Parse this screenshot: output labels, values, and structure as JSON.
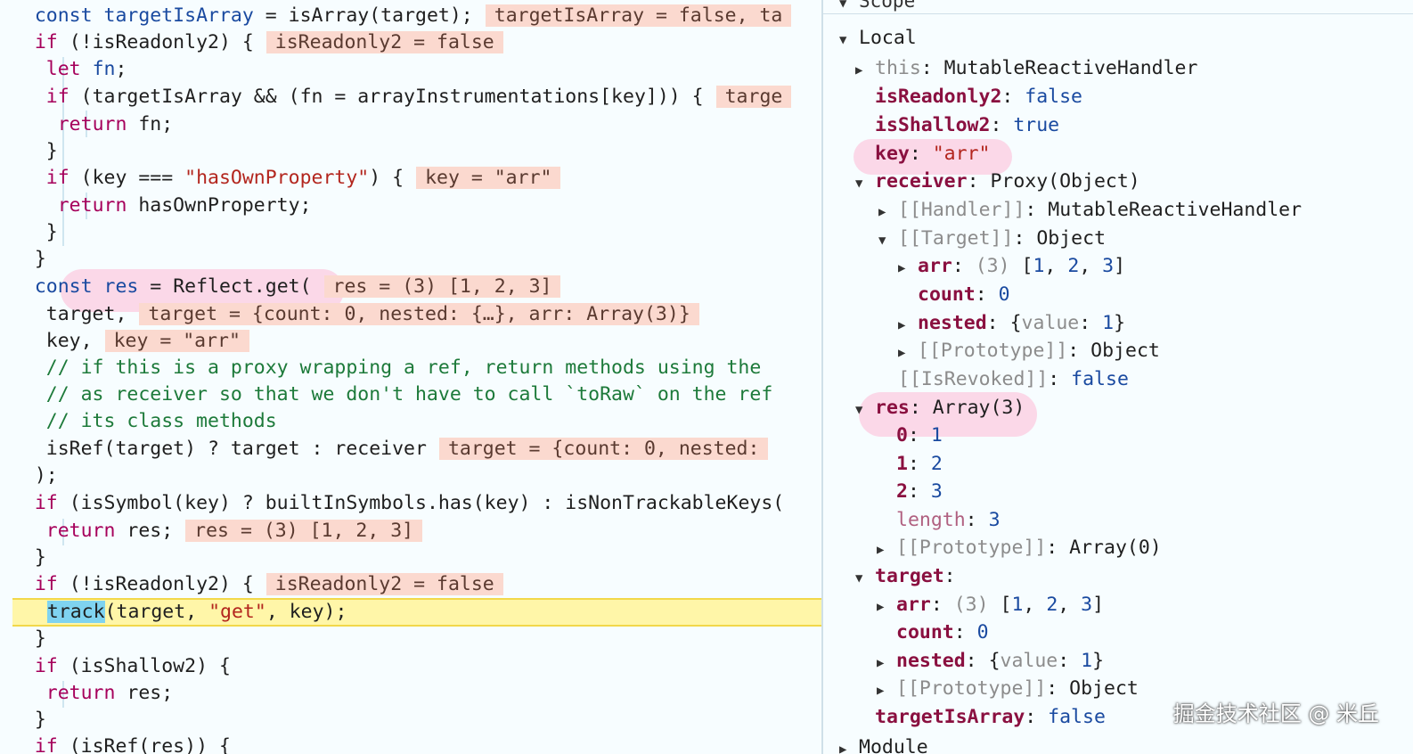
{
  "code": {
    "l1": {
      "a": "const ",
      "b": "targetIsArray",
      "c": " = isArray(target);",
      "inline": "targetIsArray = false, ta"
    },
    "l2": {
      "a": "if ",
      "b": "(!isReadonly2) {",
      "inline": "isReadonly2 = false"
    },
    "l3": {
      "a": "let ",
      "b": "fn",
      "c": ";"
    },
    "l4": {
      "a": "if ",
      "b": "(targetIsArray && (fn = arrayInstrumentations[key])) {",
      "inline": "targe"
    },
    "l5": {
      "a": "return ",
      "b": "fn;"
    },
    "l6": "}",
    "l7": {
      "a": "if ",
      "b": "(key === ",
      "s": "\"hasOwnProperty\"",
      "c": ") {",
      "inline": "key = \"arr\""
    },
    "l8": {
      "a": "return ",
      "b": "hasOwnProperty;"
    },
    "l9": "}",
    "l10": "}",
    "l11": {
      "a": "const ",
      "b": "res",
      "c": " = Reflect.get(",
      "inline": "res = (3) [1, 2, 3]"
    },
    "l12": {
      "b": "target,",
      "inline": "target = {count: 0, nested: {…}, arr: Array(3)}"
    },
    "l13": {
      "b": "key,",
      "inline": "key = \"arr\""
    },
    "l14": "// if this is a proxy wrapping a ref, return methods using the",
    "l15": "// as receiver so that we don't have to call `toRaw` on the ref",
    "l16": "// its class methods",
    "l17": {
      "b": "isRef(target) ? target : receiver",
      "inline": "target = {count: 0, nested:"
    },
    "l18": ");",
    "l19": {
      "a": "if ",
      "b": "(isSymbol(key) ? builtInSymbols.has(key) : isNonTrackableKeys("
    },
    "l20": {
      "a": "return ",
      "b": "res;",
      "inline": "res = (3) [1, 2, 3]"
    },
    "l21": "}",
    "l22": {
      "a": "if ",
      "b": "(!isReadonly2) {",
      "inline": "isReadonly2 = false"
    },
    "l23": {
      "sel": "track",
      "b": "(target, ",
      "s": "\"get\"",
      "c": ", key);"
    },
    "l24": "}",
    "l25": {
      "a": "if ",
      "b": "(isShallow2) {"
    },
    "l26": {
      "a": "return ",
      "b": "res;"
    },
    "l27": "}",
    "l28": {
      "a": "if ",
      "b": "(isRef(res)) {"
    }
  },
  "scope": {
    "header": "Scope",
    "local": "Local",
    "rows": [
      {
        "k": "this",
        "v": "MutableReactiveHandler"
      },
      {
        "k": "isReadonly2",
        "v": "false"
      },
      {
        "k": "isShallow2",
        "v": "true"
      },
      {
        "k": "key",
        "v": "\"arr\""
      },
      {
        "k": "receiver",
        "v": "Proxy(Object)"
      },
      {
        "k": "[[Handler]]",
        "v": "MutableReactiveHandler"
      },
      {
        "k": "[[Target]]",
        "v": "Object"
      },
      {
        "k": "arr",
        "v1": "(3)",
        "v2": " [",
        "n1": "1",
        ",1": ", ",
        "n2": "2",
        ",2": ", ",
        "n3": "3",
        "v3": "]"
      },
      {
        "k": "count",
        "v": "0"
      },
      {
        "k": "nested",
        "v1": "{",
        "vk": "value",
        "v2": ": ",
        "vn": "1",
        "v3": "}"
      },
      {
        "k": "[[Prototype]]",
        "v": "Object"
      },
      {
        "k": "[[IsRevoked]]",
        "v": "false"
      },
      {
        "k": "res",
        "v": "Array(3)"
      },
      {
        "k": "0",
        "v": "1"
      },
      {
        "k": "1",
        "v": "2"
      },
      {
        "k": "2",
        "v": "3"
      },
      {
        "k": "length",
        "v": "3"
      },
      {
        "k": "[[Prototype]]",
        "v": "Array(0)"
      },
      {
        "k": "target",
        "v": ""
      },
      {
        "k": "arr",
        "v1": "(3)",
        "v2": " [",
        "n1": "1",
        ",1": ", ",
        "n2": "2",
        ",2": ", ",
        "n3": "3",
        "v3": "]"
      },
      {
        "k": "count",
        "v": "0"
      },
      {
        "k": "nested",
        "v1": "{",
        "vk": "value",
        "v2": ": ",
        "vn": "1",
        "v3": "}"
      },
      {
        "k": "[[Prototype]]",
        "v": "Object"
      },
      {
        "k": "targetIsArray",
        "v": "false"
      },
      {
        "k": "Module",
        "v": ""
      }
    ]
  },
  "watermark": "掘金技术社区 @ 米丘"
}
